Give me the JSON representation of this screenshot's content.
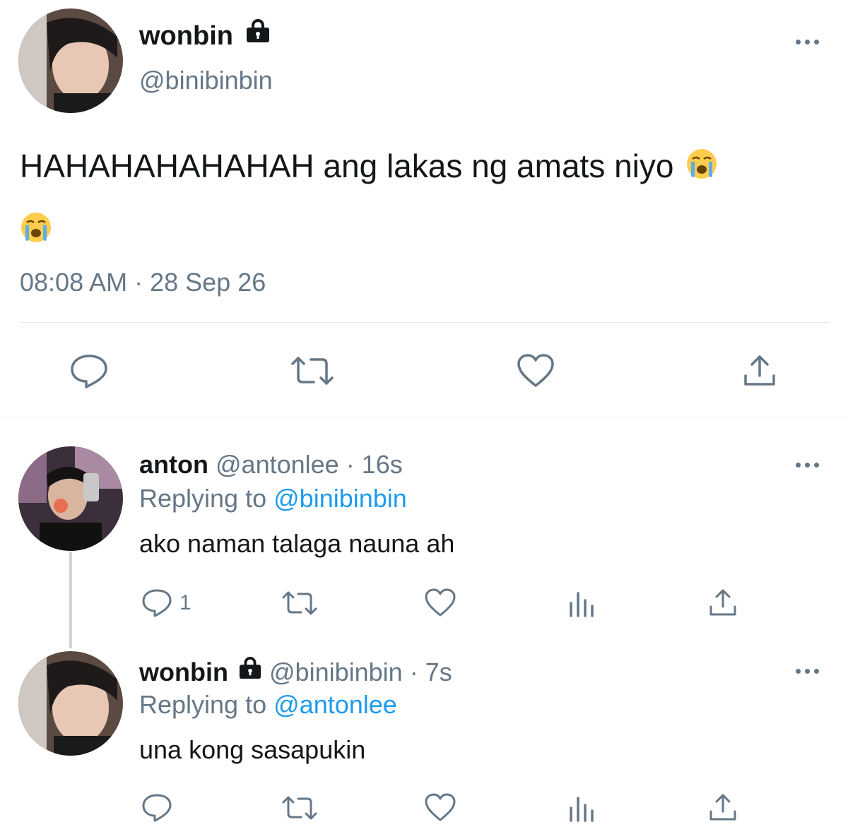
{
  "main_tweet": {
    "display_name": "wonbin",
    "handle": "@binibinbin",
    "text": "HAHAHAHAHAHAH ang lakas ng amats niyo",
    "timestamp": "08:08 AM · 28 Sep 26",
    "locked": true
  },
  "replies": [
    {
      "display_name": "anton",
      "handle": "@antonlee",
      "time": "· 16s",
      "replying_prefix": "Replying to",
      "replying_to": "@binibinbin",
      "text": "ako naman talaga nauna ah",
      "reply_count": "1",
      "locked": false
    },
    {
      "display_name": "wonbin",
      "handle": "@binibinbin",
      "time": "· 7s",
      "replying_prefix": "Replying to",
      "replying_to": "@antonlee",
      "text": "una kong sasapukin",
      "reply_count": "",
      "locked": true
    }
  ],
  "icons": {
    "lock": "lock-icon",
    "more": "more-horizontal-icon",
    "reply": "reply-icon",
    "retweet": "retweet-icon",
    "like": "heart-icon",
    "share": "share-icon",
    "analytics": "analytics-icon",
    "emoji": "loudly-crying-face-emoji"
  },
  "colors": {
    "text": "#14171a",
    "muted": "#657786",
    "link": "#1d9bf0",
    "divider": "#e1e8ed"
  }
}
